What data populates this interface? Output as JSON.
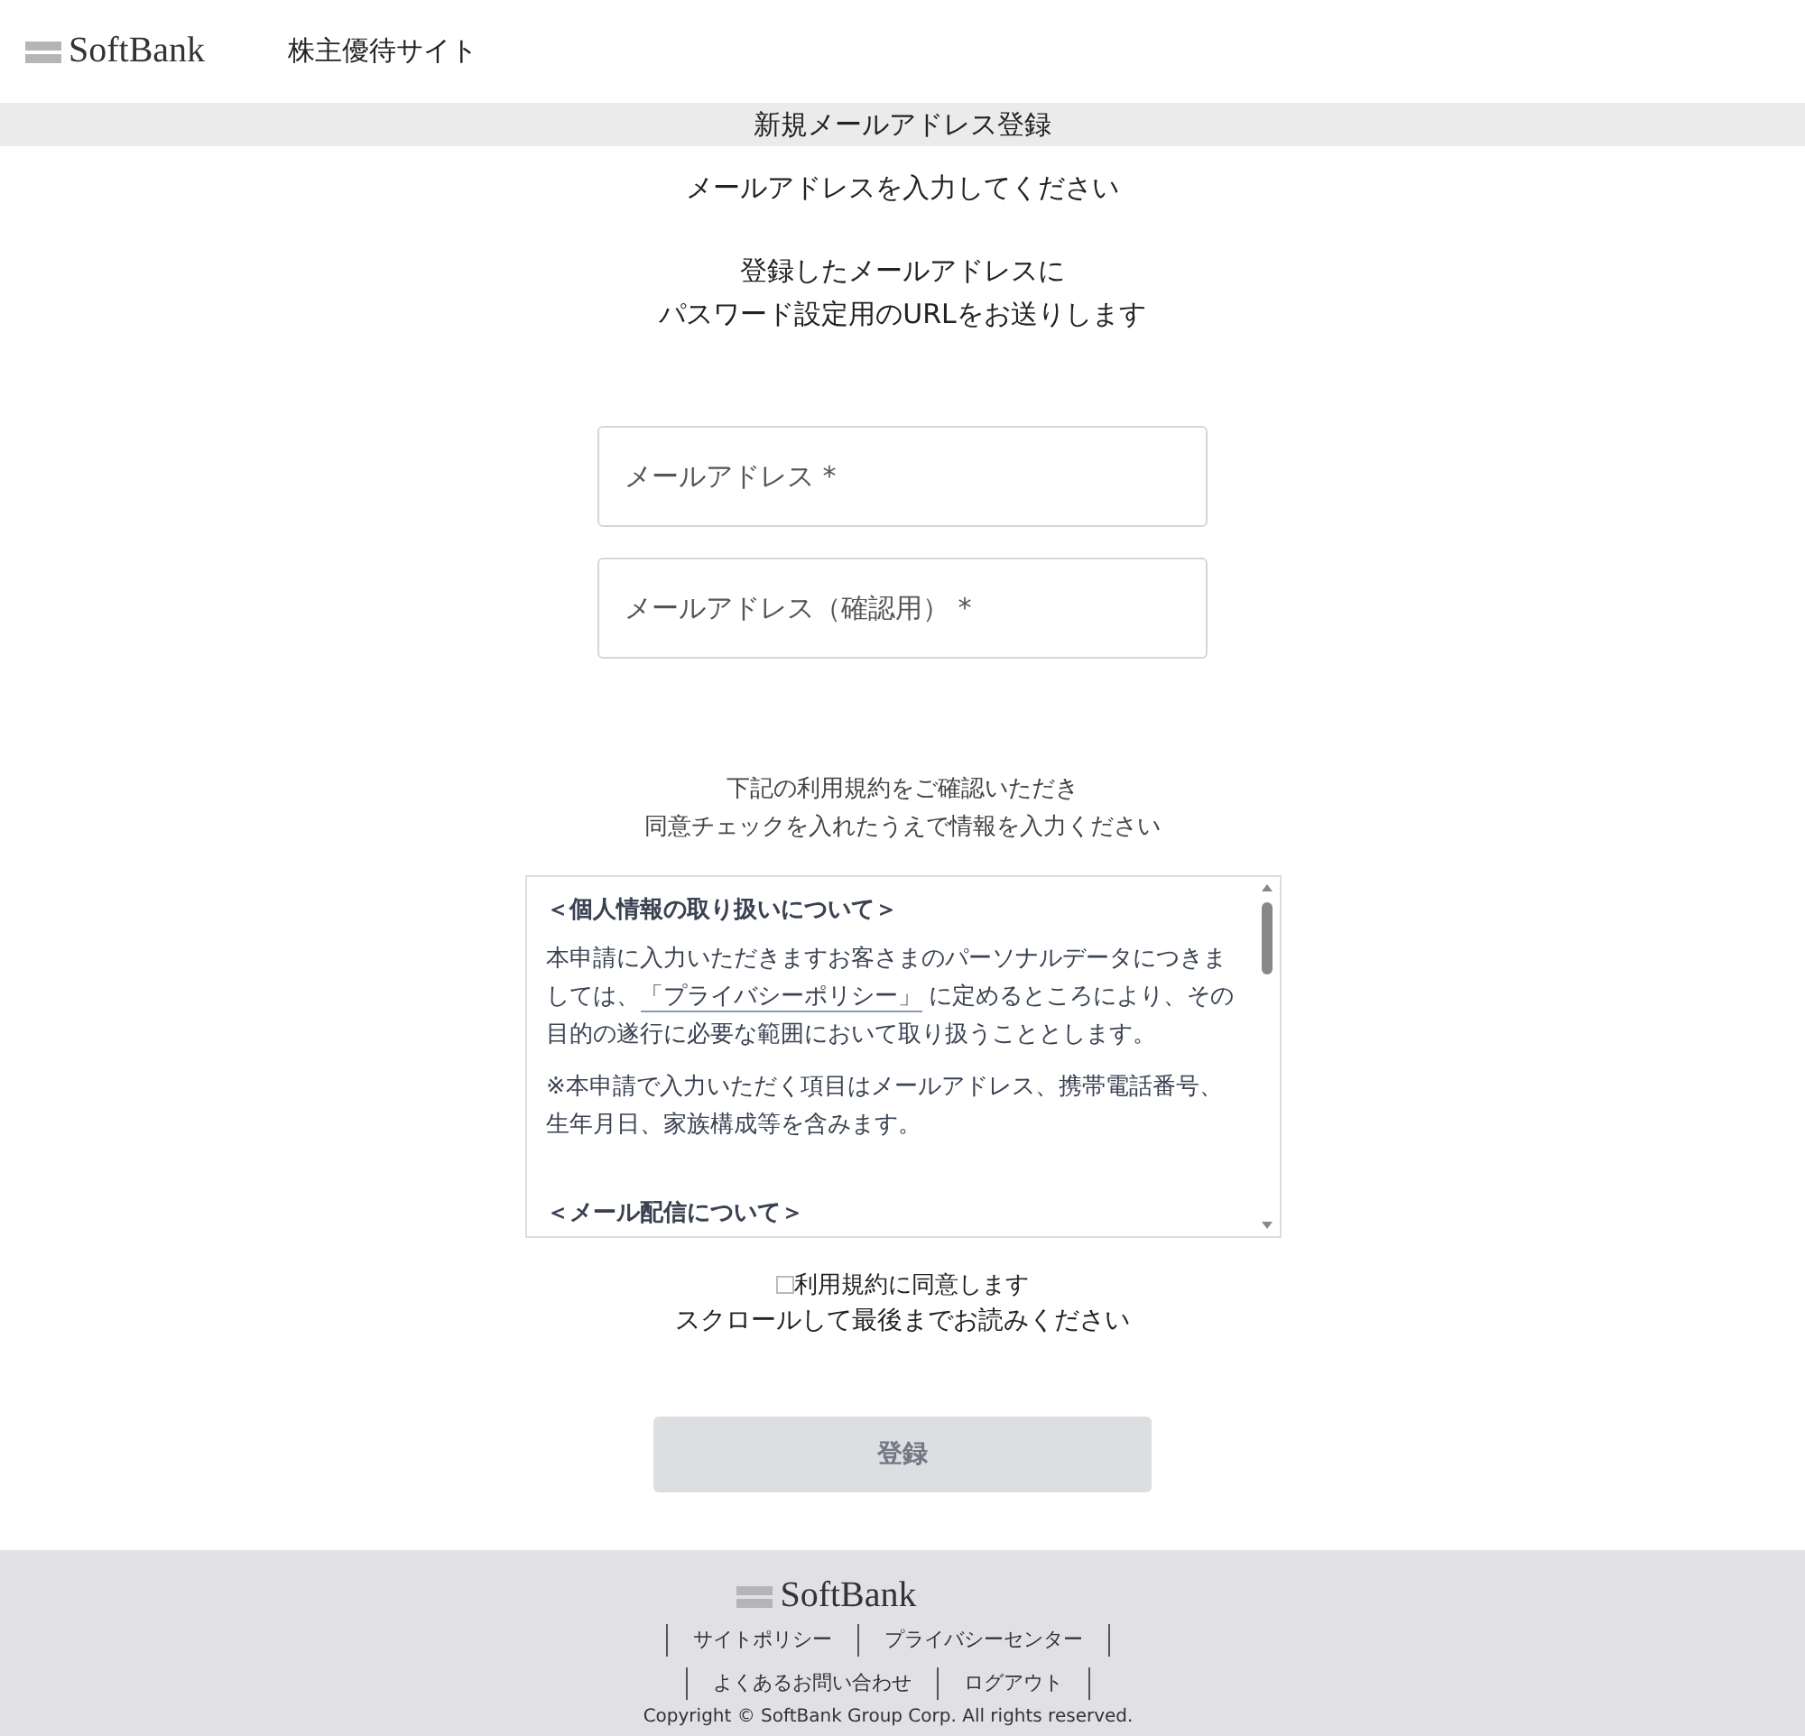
{
  "header": {
    "logo": "SoftBank",
    "site_name": "株主優待サイト"
  },
  "page_title": "新規メールアドレス登録",
  "instruction": "メールアドレスを入力してください",
  "note_lines": [
    "登録したメールアドレスに",
    "パスワード設定用のURLをお送りします"
  ],
  "fields": [
    {
      "placeholder": "メールアドレス *"
    },
    {
      "placeholder": "メールアドレス（確認用） *"
    }
  ],
  "terms_intro": [
    "下記の利用規約をご確認いただき",
    "同意チェックを入れたうえで情報を入力ください"
  ],
  "terms": [
    {
      "kind": "heading",
      "text": "＜個人情報の取り扱いについて＞"
    },
    {
      "kind": "paragraph",
      "text": "本申請に入力いただきますお客さまのパーソナルデータにつきましては、",
      "link": "「プライバシーポリシー」",
      "after": " に定めるところにより、その目的の遂行に必要な範囲において取り扱うこととします。"
    },
    {
      "kind": "paragraph",
      "text": "※本申請で入力いただく項目はメールアドレス、携帯電話番号、生年月日、家族構成等を含みます。"
    },
    {
      "kind": "heading",
      "text": "＜メール配信について＞"
    }
  ],
  "agree": {
    "label": "利用規約に同意します",
    "checked": false
  },
  "scroll_hint": "スクロールして最後までお読みください",
  "submit": {
    "label": "登録",
    "disabled": true
  },
  "footer": {
    "logo": "SoftBank",
    "links": [
      [
        "サイトポリシー",
        "プライバシーセンター"
      ],
      [
        "よくあるお問い合わせ",
        "ログアウト"
      ]
    ],
    "copyright": "Copyright © SoftBank Group Corp. All rights reserved."
  }
}
